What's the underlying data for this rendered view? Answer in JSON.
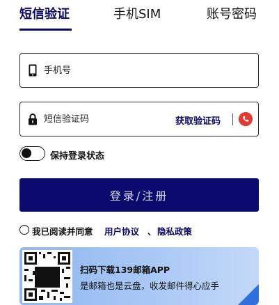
{
  "tabs": [
    {
      "label": "短信验证",
      "active": true
    },
    {
      "label": "手机SIM",
      "active": false
    },
    {
      "label": "账号密码",
      "active": false
    }
  ],
  "phone": {
    "placeholder": "手机号",
    "icon": "phone-icon"
  },
  "sms_code": {
    "placeholder": "短信验证码",
    "icon": "lock-icon",
    "get_code_label": "获取验证码",
    "voice_icon": "voice-code-icon"
  },
  "remember": {
    "label": "保持登录状态",
    "enabled": false
  },
  "login_button": {
    "label": "登录/注册"
  },
  "agreement": {
    "prefix": "我已阅读并同意",
    "terms_label": "用户协议",
    "separator": "、",
    "privacy_label": "隐私政策"
  },
  "banner": {
    "title": "扫码下载139邮箱APP",
    "subtitle": "是邮箱也是云盘，收发邮件得心应手"
  },
  "colors": {
    "primary": "#0b0b6e",
    "accent_red": "#e53935",
    "banner_blue": "#8fb7f0"
  }
}
